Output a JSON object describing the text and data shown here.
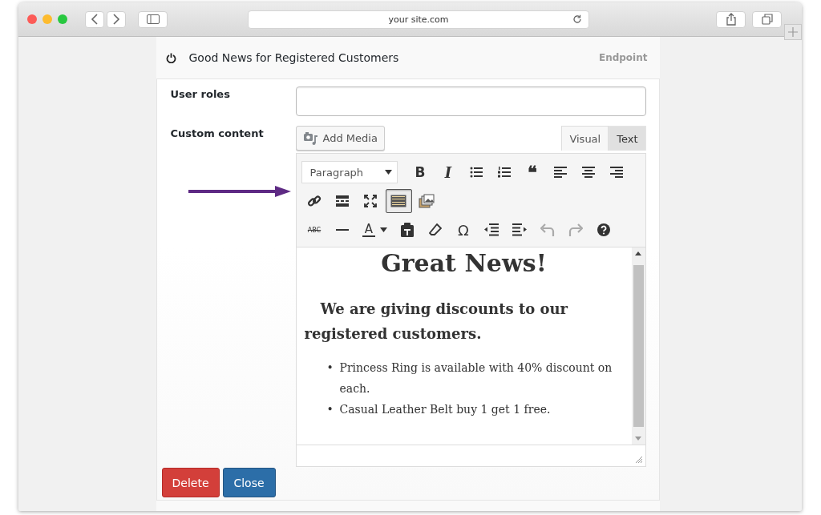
{
  "browser": {
    "address": "your site.com"
  },
  "panel": {
    "title": "Good News for Registered Customers",
    "endpoint": "Endpoint"
  },
  "form": {
    "user_roles_label": "User roles",
    "custom_content_label": "Custom content",
    "add_media": "Add Media",
    "tabs": [
      {
        "label": "Visual",
        "selected": true
      },
      {
        "label": "Text",
        "selected": false
      }
    ]
  },
  "toolbar": {
    "format_select": "Paragraph",
    "bold": "B",
    "italic": "I",
    "quote": "❝",
    "strike": "ABC",
    "text_color": "A",
    "special_char": "Ω",
    "toolbar_toggle": {
      "selected": true
    },
    "undo": {
      "disabled": true
    },
    "redo": {
      "disabled": true
    }
  },
  "content": {
    "heading": "Great News!",
    "paragraph": "We are giving discounts to our registered customers.",
    "bullets": [
      {
        "marker": "•",
        "text": "Princess Ring is available with 40% discount on each."
      },
      {
        "marker": "•",
        "text": "Casual Leather Belt buy 1 get 1 free."
      }
    ]
  },
  "buttons": [
    {
      "label": "Delete",
      "kind": "danger"
    },
    {
      "label": "Close",
      "kind": "primary"
    }
  ]
}
